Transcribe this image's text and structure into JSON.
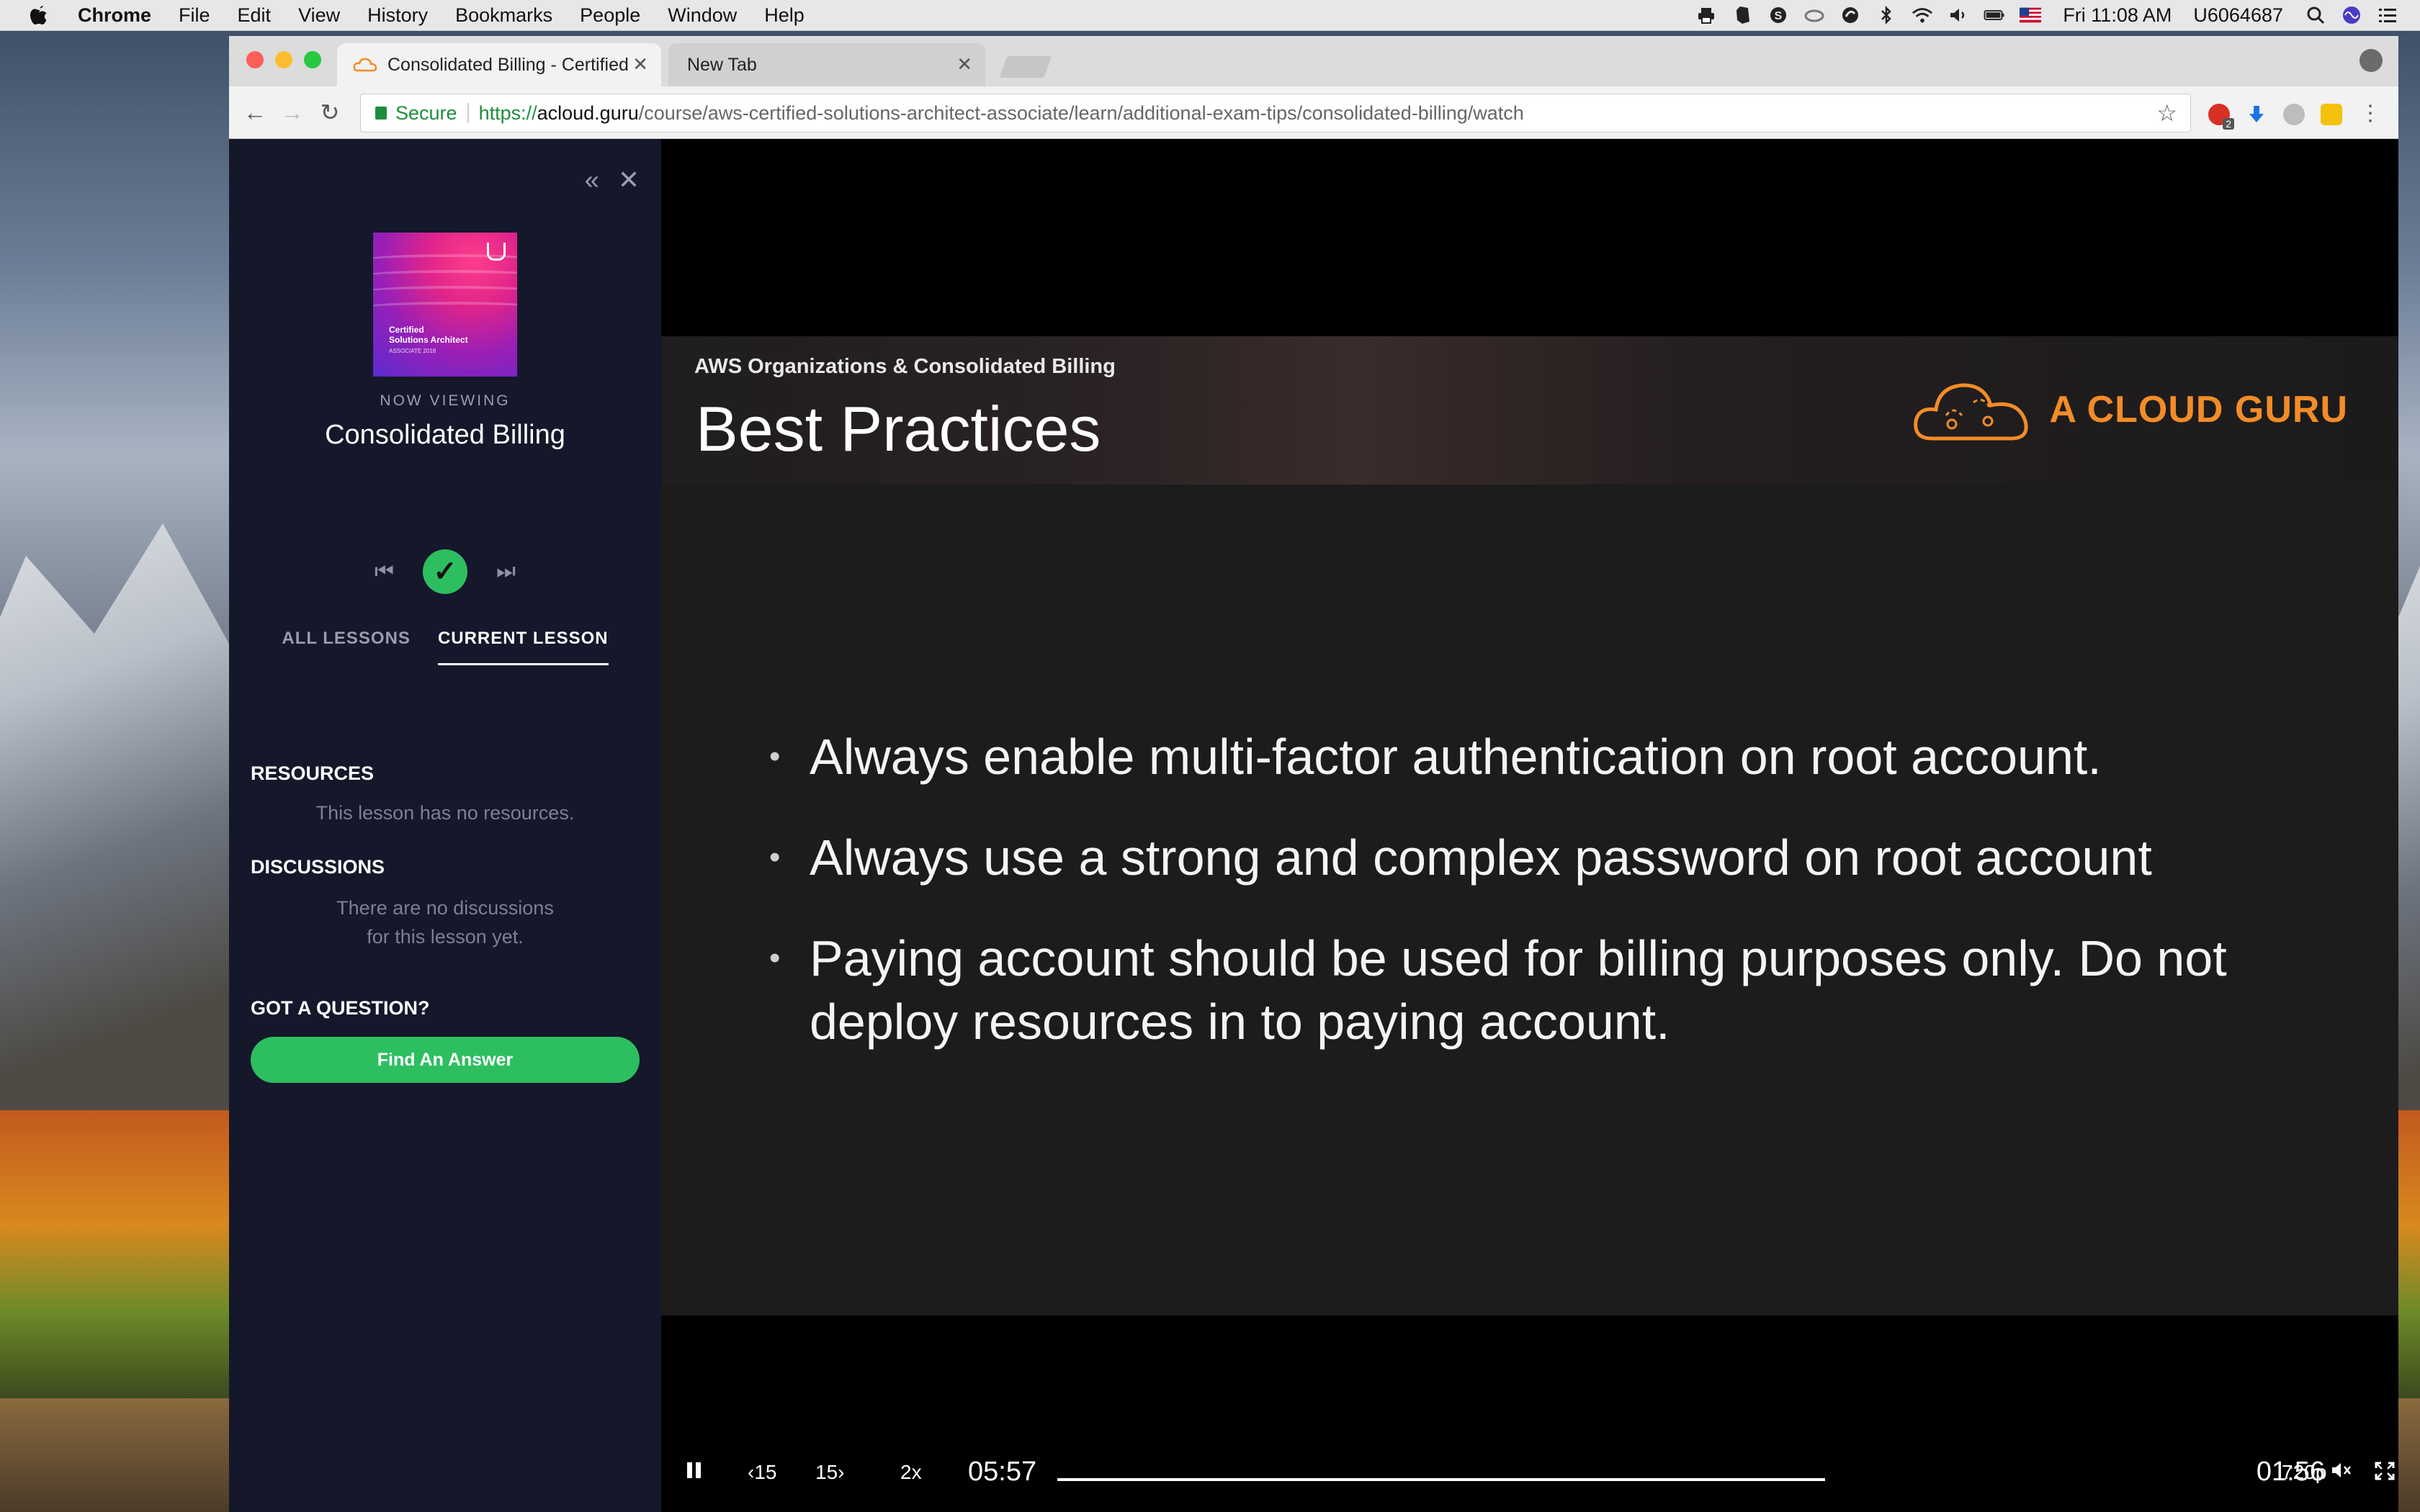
{
  "menubar": {
    "app": "Chrome",
    "items": [
      "File",
      "Edit",
      "View",
      "History",
      "Bookmarks",
      "People",
      "Window",
      "Help"
    ],
    "clock": "Fri 11:08 AM",
    "user": "U6064687"
  },
  "browser": {
    "tabs": [
      {
        "title": "Consolidated Billing - Certified"
      },
      {
        "title": "New Tab"
      }
    ],
    "address": {
      "secure_label": "Secure",
      "scheme": "https://",
      "host": "acloud.guru",
      "path": "/course/aws-certified-solutions-architect-associate/learn/additional-exam-tips/consolidated-billing/watch"
    },
    "extension_badge": "2"
  },
  "sidebar": {
    "course_image": {
      "title_line1": "Certified",
      "title_line2": "Solutions Architect",
      "subtitle": "ASSOCIATE 2018"
    },
    "now_viewing_label": "NOW VIEWING",
    "lesson_title": "Consolidated Billing",
    "tabs": [
      {
        "label": "ALL LESSONS",
        "active": false
      },
      {
        "label": "CURRENT LESSON",
        "active": true
      }
    ],
    "resources": {
      "heading": "RESOURCES",
      "empty_text": "This lesson has no resources."
    },
    "discussions": {
      "heading": "DISCUSSIONS",
      "empty_line1": "There are no discussions",
      "empty_line2": "for this lesson yet."
    },
    "question": {
      "heading": "GOT A QUESTION?",
      "button_label": "Find An Answer"
    }
  },
  "slide": {
    "subtitle": "AWS Organizations & Consolidated Billing",
    "title": "Best Practices",
    "logo_text": "A CLOUD GURU",
    "bullets": [
      "Always enable multi-factor authentication on root account.",
      "Always use a strong and complex password on root account",
      "Paying account should be used for billing purposes only. Do not deploy resources in to paying account."
    ]
  },
  "player_controls": {
    "rewind_label": "15",
    "forward_label": "15",
    "speed": "2x",
    "elapsed": "05:57",
    "remaining": "01:56",
    "quality": "720p",
    "progress_fraction": 1.0
  },
  "colors": {
    "accent_green": "#2dbe60",
    "brand_orange": "#f28c28",
    "sidebar_bg": "#15172a"
  }
}
